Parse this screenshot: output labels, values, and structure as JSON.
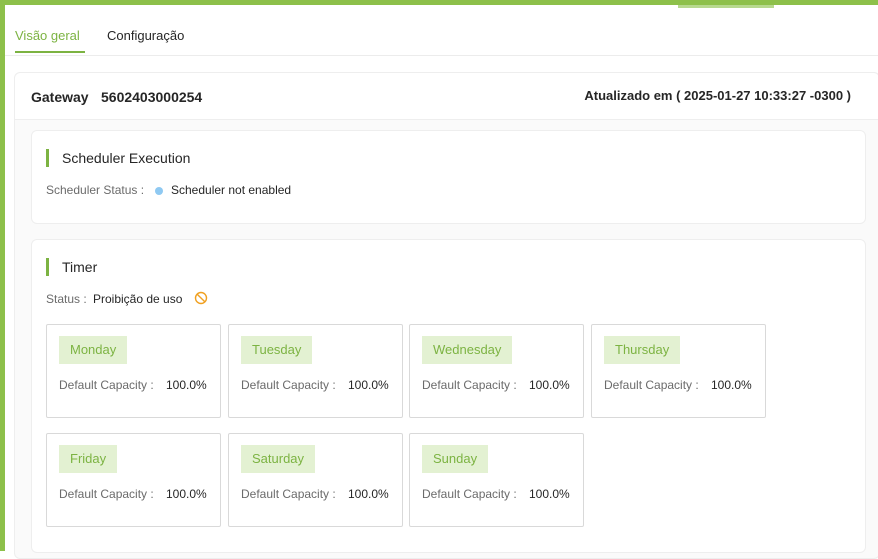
{
  "tabs": [
    {
      "label": "Visão geral",
      "active": true
    },
    {
      "label": "Configuração",
      "active": false
    }
  ],
  "gateway": {
    "label": "Gateway",
    "id": "5602403000254",
    "updated": "Atualizado em ( 2025-01-27 10:33:27 -0300 )"
  },
  "scheduler": {
    "title": "Scheduler Execution",
    "status_label": "Scheduler Status :",
    "status_value": "Scheduler not enabled",
    "status_color": "#8fc9f2"
  },
  "timer": {
    "title": "Timer",
    "status_label": "Status :",
    "status_value": "Proibição de uso",
    "status_icon": "ban-icon",
    "capacity_label": "Default Capacity :",
    "days": [
      {
        "name": "Monday",
        "capacity": "100.0%"
      },
      {
        "name": "Tuesday",
        "capacity": "100.0%"
      },
      {
        "name": "Wednesday",
        "capacity": "100.0%"
      },
      {
        "name": "Thursday",
        "capacity": "100.0%"
      },
      {
        "name": "Friday",
        "capacity": "100.0%"
      },
      {
        "name": "Saturday",
        "capacity": "100.0%"
      },
      {
        "name": "Sunday",
        "capacity": "100.0%"
      }
    ]
  },
  "colors": {
    "accent": "#7cb342",
    "frame": "#8dc04a",
    "tag_bg": "#e3f1d2"
  }
}
